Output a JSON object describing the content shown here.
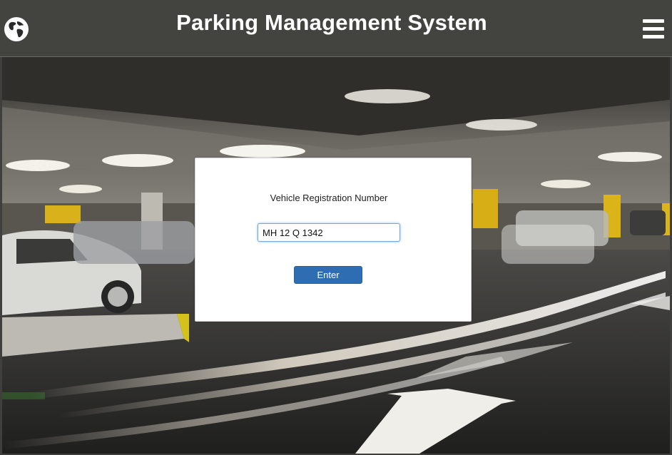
{
  "header": {
    "title": "Parking Management System",
    "logo_icon": "globe-icon",
    "menu_icon": "hamburger-menu-icon"
  },
  "background": {
    "description_icon": "parking-garage-photo"
  },
  "form": {
    "label": "Vehicle Registration Number",
    "input_value": "MH 12 Q 1342",
    "button_label": "Enter"
  },
  "colors": {
    "header_bg": "#434340",
    "button_bg": "#2f6db3",
    "input_focus_border": "#7aa7d9"
  }
}
